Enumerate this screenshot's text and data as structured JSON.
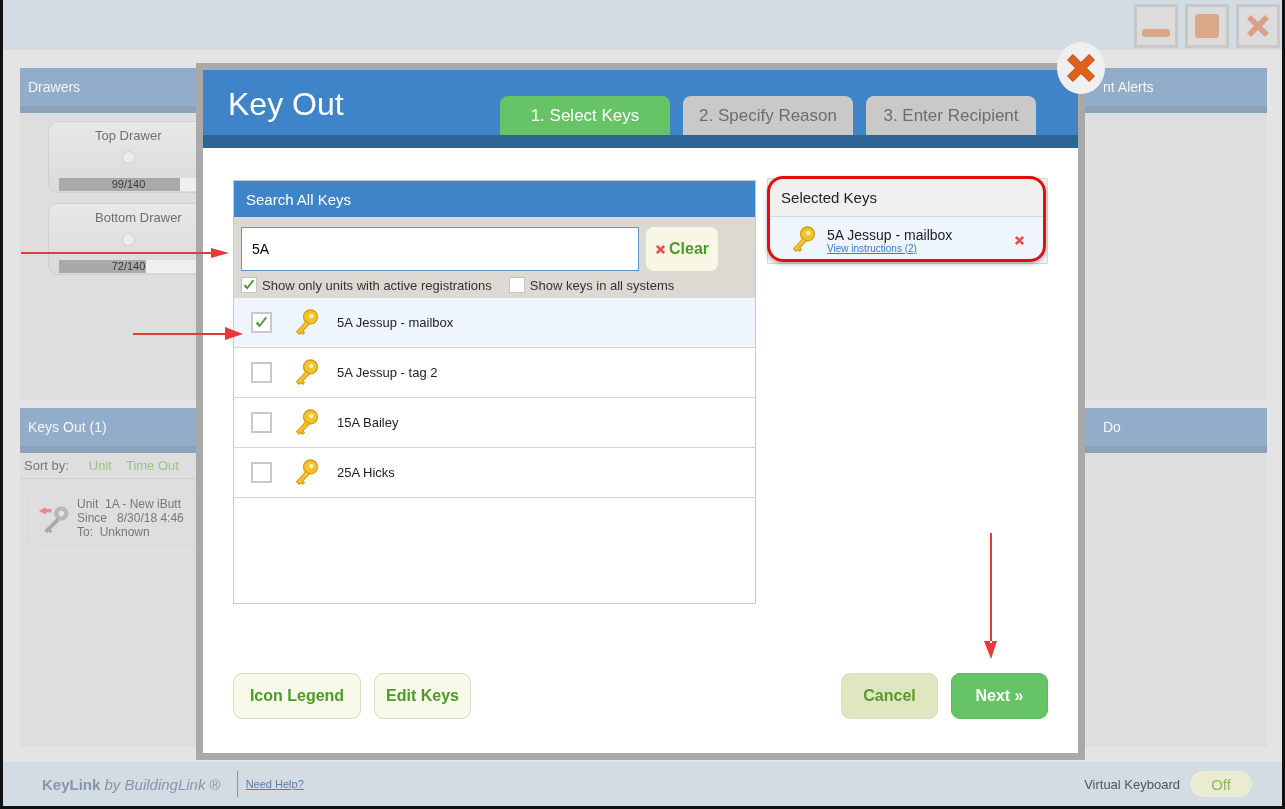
{
  "background": {
    "drawers_panel": {
      "title": "Drawers",
      "drawers": [
        {
          "name": "Top Drawer",
          "reading": "99/140",
          "level": 0.71
        },
        {
          "name": "Bottom Drawer",
          "reading": "72/140",
          "level": 0.51
        }
      ]
    },
    "keys_out_panel": {
      "title": "Keys Out (1)",
      "sort_label": "Sort by:",
      "sort_options": [
        {
          "label": "Unit"
        },
        {
          "label": "Time Out"
        }
      ],
      "entries": [
        {
          "lines": [
            "Unit  1A - New iButt",
            "Since   8/30/18 4:46",
            "To:  Unknown"
          ]
        }
      ]
    },
    "right_panels": [
      {
        "title": "nt Alerts"
      },
      {
        "title": "Do"
      }
    ]
  },
  "dialog": {
    "title": "Key Out",
    "tabs": [
      {
        "label": "1. Select Keys",
        "selected": true
      },
      {
        "label": "2. Specify Reason",
        "selected": false
      },
      {
        "label": "3. Enter Recipient",
        "selected": false
      }
    ],
    "search": {
      "title": "Search All Keys",
      "value": "5A",
      "clear_label": "Clear",
      "filters": [
        {
          "label": "Show only units with active registrations",
          "checked": true
        },
        {
          "label": "Show keys in all systems",
          "checked": false
        }
      ],
      "results": [
        {
          "name": "5A Jessup - mailbox",
          "checked": true,
          "selected": true
        },
        {
          "name": "5A Jessup - tag 2",
          "checked": false,
          "selected": false
        },
        {
          "name": "15A Bailey",
          "checked": false,
          "selected": false
        },
        {
          "name": "25A Hicks",
          "checked": false,
          "selected": false
        }
      ]
    },
    "selected_keys": {
      "title": "Selected Keys",
      "items": [
        {
          "name": "5A Jessup - mailbox",
          "link": "View instructions (2)"
        }
      ]
    },
    "buttons": [
      {
        "label": "Icon Legend",
        "kind": "secondary"
      },
      {
        "label": "Edit Keys",
        "kind": "secondary"
      },
      {
        "label": "Cancel",
        "kind": "cancel"
      },
      {
        "label": "Next »",
        "kind": "primary"
      }
    ]
  },
  "footer": {
    "brand": "**KeyLink** *by BuildingLink* ®",
    "help_link": "Need Help?",
    "keyboard_label": "Virtual Keyboard",
    "keyboard_toggle": {
      "label": "Off",
      "on": false
    }
  }
}
